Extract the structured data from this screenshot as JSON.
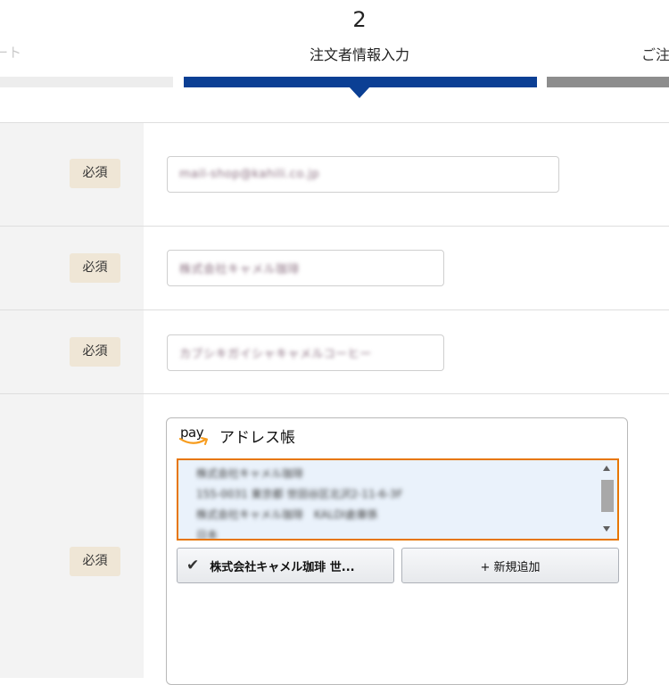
{
  "steps": {
    "prev_label": "ート",
    "current_number": "2",
    "current_label": "注文者情報入力",
    "next_label": "ご注"
  },
  "form": {
    "required_label": "必須",
    "email_value": "mail-shop@kahili.co.jp",
    "company_value": "株式会社キャメル珈琲",
    "company_kana_value": "カブシキガイシャキャメルコーヒー"
  },
  "amazon_pay": {
    "logo_text": "pay",
    "title": "アドレス帳",
    "address_lines": [
      "株式会社キャメル珈琲",
      "155-0031 東京都 世田谷区北沢2-11-6-3F",
      "株式会社キャメル珈琲　KALDI倉庫係",
      "日本"
    ],
    "selected_address_button": "株式会社キャメル珈琲 世...",
    "add_new_button": "+ 新規追加"
  },
  "colors": {
    "step_active": "#0b3f94",
    "step_done": "#ededed",
    "step_next": "#8d8d8d",
    "required_badge_bg": "#efe6d6",
    "address_highlight": "#e77600"
  }
}
